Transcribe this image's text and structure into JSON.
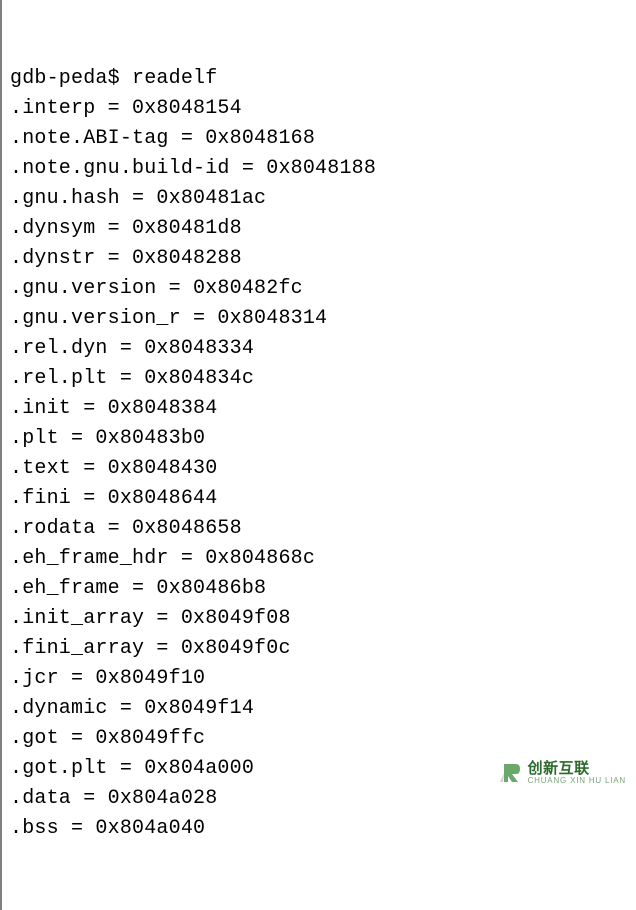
{
  "terminal": {
    "prompt": "gdb-peda$ ",
    "command": "readelf",
    "lines": [
      ".interp = 0x8048154",
      ".note.ABI-tag = 0x8048168",
      ".note.gnu.build-id = 0x8048188",
      ".gnu.hash = 0x80481ac",
      ".dynsym = 0x80481d8",
      ".dynstr = 0x8048288",
      ".gnu.version = 0x80482fc",
      ".gnu.version_r = 0x8048314",
      ".rel.dyn = 0x8048334",
      ".rel.plt = 0x804834c",
      ".init = 0x8048384",
      ".plt = 0x80483b0",
      ".text = 0x8048430",
      ".fini = 0x8048644",
      ".rodata = 0x8048658",
      ".eh_frame_hdr = 0x804868c",
      ".eh_frame = 0x80486b8",
      ".init_array = 0x8049f08",
      ".fini_array = 0x8049f0c",
      ".jcr = 0x8049f10",
      ".dynamic = 0x8049f14",
      ".got = 0x8049ffc",
      ".got.plt = 0x804a000",
      ".data = 0x804a028",
      ".bss = 0x804a040"
    ]
  },
  "watermark": {
    "major": "创新互联",
    "minor": "CHUANG XIN HU LIAN"
  }
}
